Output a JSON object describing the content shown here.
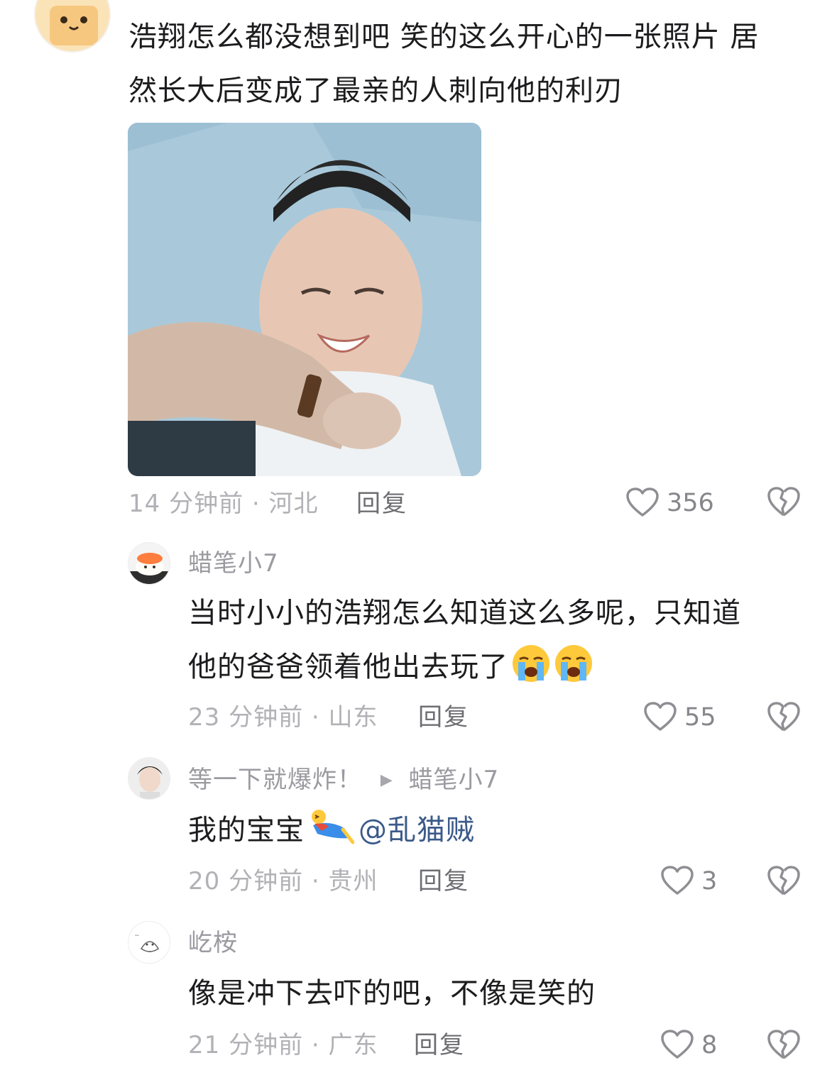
{
  "comments": [
    {
      "text_line1": "浩翔怎么都没想到吧 笑的这么开心的一张照片 居",
      "text_line2": "然长大后变成了最亲的人刺向他的利刃",
      "meta": "14 分钟前 · 河北",
      "reply": "回复",
      "likes": "356"
    }
  ],
  "replies": [
    {
      "username": "蜡笔小7",
      "text_line1": "当时小小的浩翔怎么知道这么多呢，只知道",
      "text_line2": "他的爸爸领着他出去玩了",
      "emojis": [
        "crying-emoji",
        "crying-emoji"
      ],
      "meta": "23 分钟前 · 山东",
      "reply": "回复",
      "likes": "55"
    },
    {
      "username": "等一下就爆炸！",
      "reply_to": "蜡笔小7",
      "text": "我的宝宝",
      "mention": "@乱猫贼",
      "meta": "20 分钟前 · 贵州",
      "reply": "回复",
      "likes": "3"
    },
    {
      "username": "屹桉",
      "text": "像是冲下去吓的吧，不像是笑的",
      "meta": "21 分钟前 · 广东",
      "reply": "回复",
      "likes": "8"
    }
  ],
  "colors": {
    "text": "#1c1c1e",
    "meta": "#b1b1b6",
    "mention": "#3c5a8a"
  }
}
